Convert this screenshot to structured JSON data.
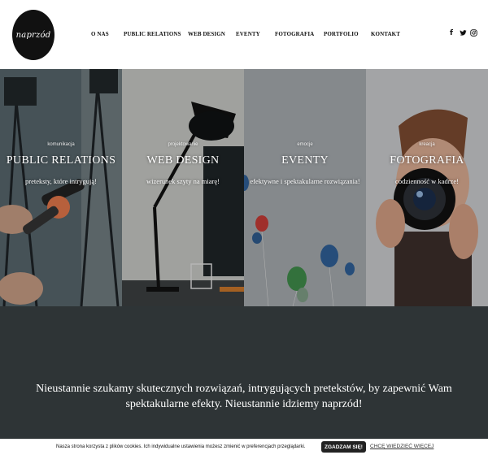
{
  "header": {
    "logo_text": "naprzód",
    "nav": [
      {
        "label": "O NAS"
      },
      {
        "label": "PUBLIC RELATIONS"
      },
      {
        "label": "WEB DESIGN"
      },
      {
        "label": "EVENTY"
      },
      {
        "label": "FOTOGRAFIA"
      },
      {
        "label": "PORTFOLIO"
      },
      {
        "label": "KONTAKT"
      }
    ],
    "social": [
      {
        "icon": "facebook-icon",
        "glyph": "f"
      },
      {
        "icon": "twitter-icon",
        "glyph": "🐦"
      },
      {
        "icon": "instagram-icon",
        "glyph": "◎"
      }
    ]
  },
  "tiles": [
    {
      "kicker": "komunikacja",
      "title": "PUBLIC RELATIONS",
      "subtitle": "preteksty, które intrygują!"
    },
    {
      "kicker": "projektowanie",
      "title": "WEB DESIGN",
      "subtitle": "wizerunek szyty na miarę!"
    },
    {
      "kicker": "emocje",
      "title": "EVENTY",
      "subtitle": "efektywne i spektakularne rozwiązania!"
    },
    {
      "kicker": "kreacja",
      "title": "FOTOGRAFIA",
      "subtitle": "codzienność w kadrze!"
    }
  ],
  "band": {
    "text": "Nieustannie szukamy skutecznych rozwiązań, intrygujących pretekstów, by zapewnić Wam spektakularne efekty. Nieustannie idziemy naprzód!"
  },
  "cookie": {
    "text": "Nasza strona korzysta z plików cookies. Ich indywidualne ustawienia możesz zmienić w preferencjach przeglądarki.",
    "accept_label": "ZGADZAM SIĘ!",
    "more_label": "CHCĘ WIEDZIEĆ WIĘCEJ"
  },
  "colors": {
    "band_bg": "#2e3436",
    "logo_bg": "#111111"
  }
}
